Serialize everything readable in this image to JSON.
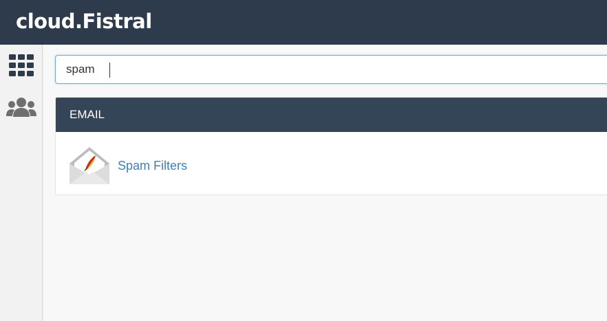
{
  "header": {
    "brand": "cloud.Fistral"
  },
  "sidebar": {
    "items": [
      {
        "icon": "grid-icon"
      },
      {
        "icon": "users-icon"
      }
    ]
  },
  "search": {
    "value": "spam"
  },
  "results": {
    "section_title": "EMAIL",
    "items": [
      {
        "label": "Spam Filters",
        "icon": "spam-filters-icon"
      }
    ]
  },
  "colors": {
    "topbar": "#2d3b4c",
    "section_header": "#344557",
    "link": "#3f7fb5",
    "focus_border": "#6aaed6"
  }
}
